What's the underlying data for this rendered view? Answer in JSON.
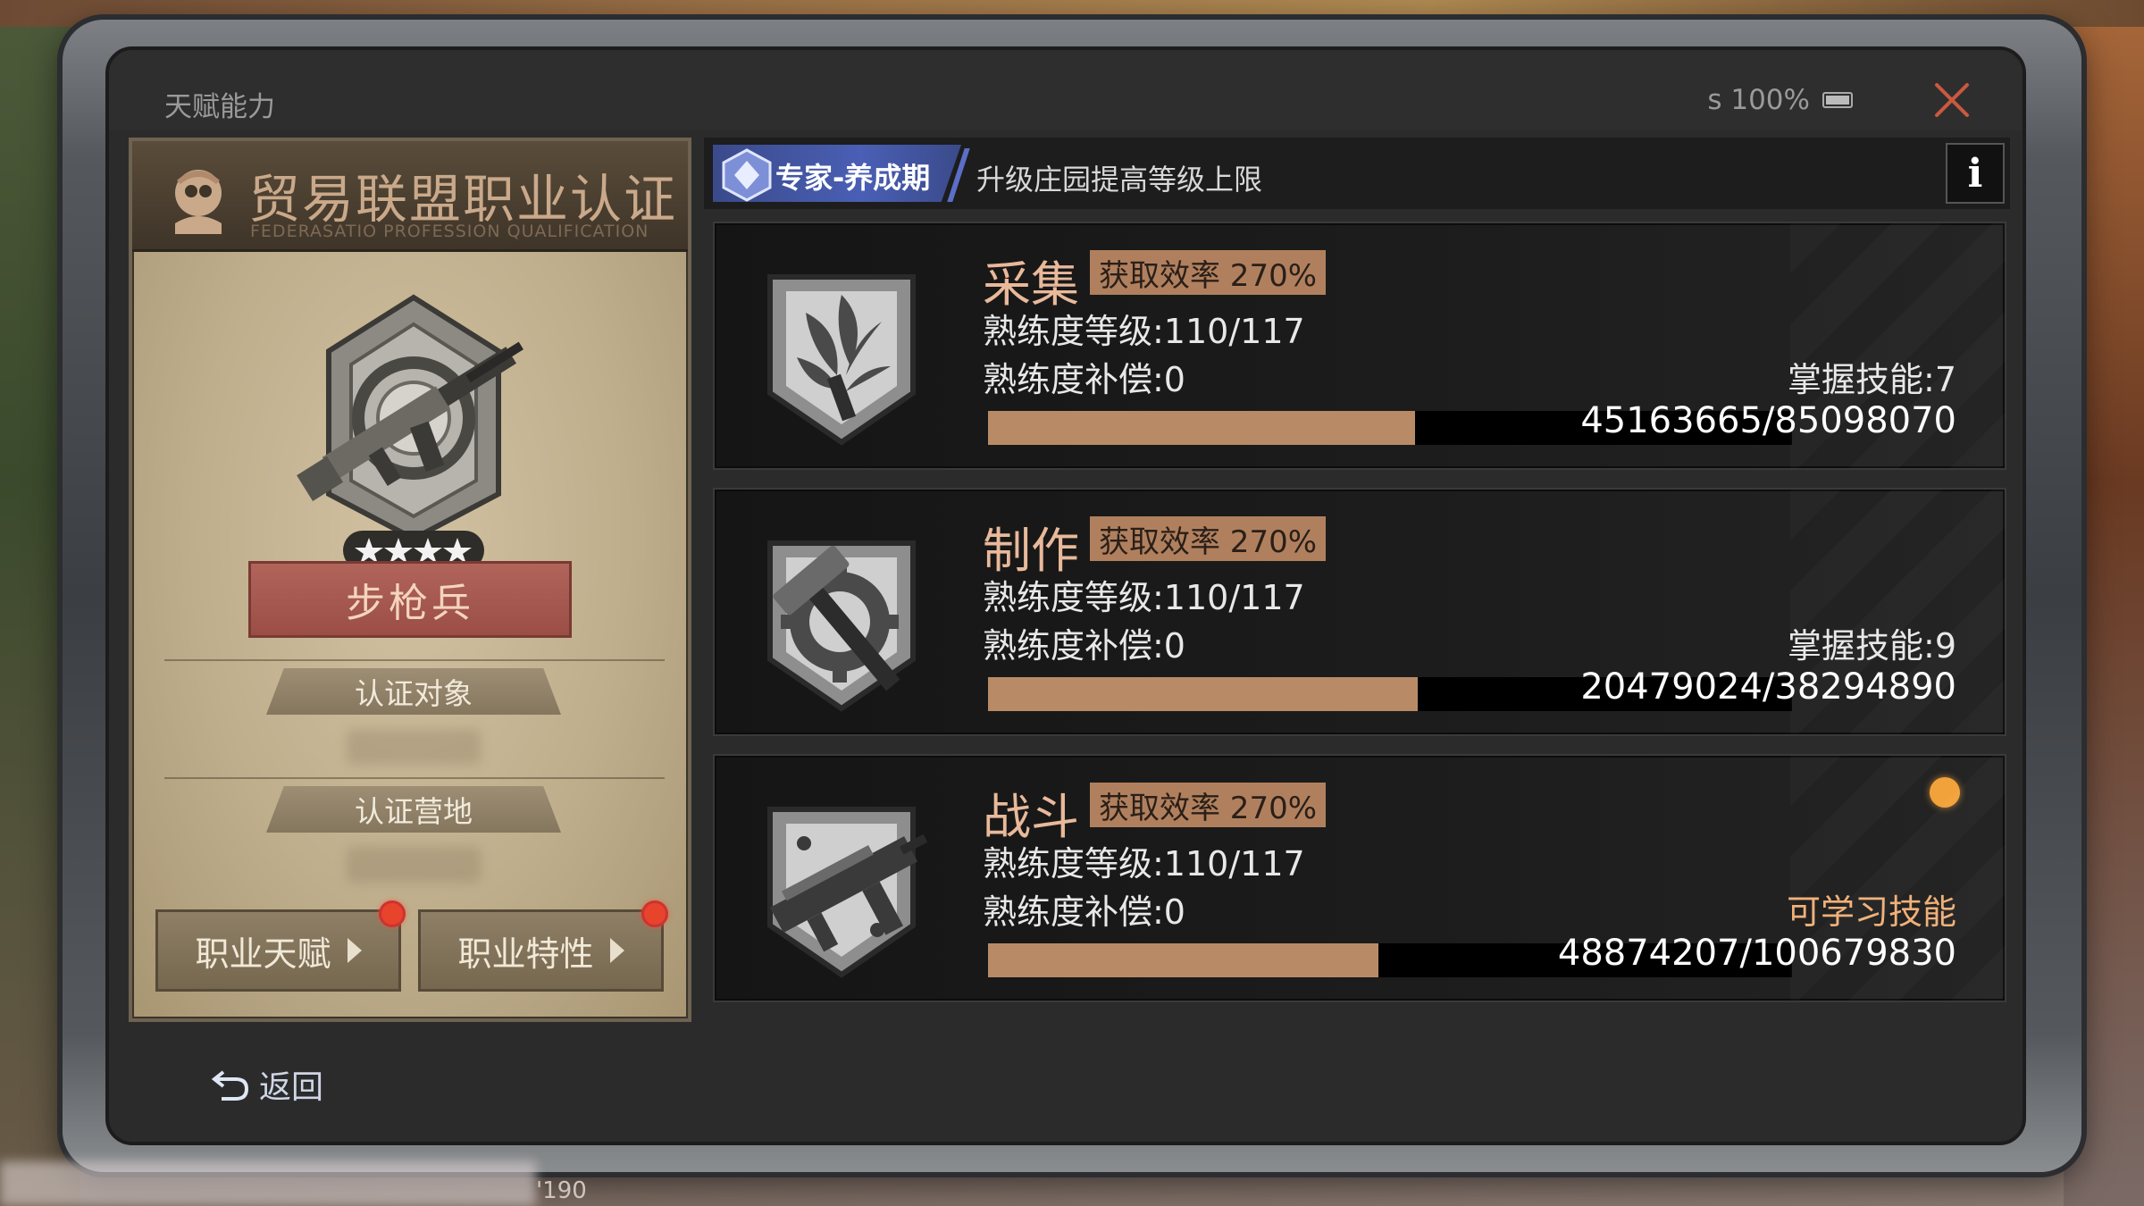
{
  "window": {
    "title": "天赋能力",
    "status_text": "s 100%"
  },
  "left_panel": {
    "cert_title": "贸易联盟职业认证",
    "cert_subtitle": "FEDERASATIO PROFESSION QUALIFICATION",
    "class_name": "步枪兵",
    "cert_target_label": "认证对象",
    "cert_camp_label": "认证营地",
    "buttons": [
      {
        "label": "职业天赋"
      },
      {
        "label": "职业特性"
      }
    ]
  },
  "right_header": {
    "tag_label": "专家-养成期",
    "description": "升级庄园提高等级上限",
    "info_label": "i"
  },
  "skills": [
    {
      "name": "采集",
      "rate": "获取效率 270%",
      "level": "熟练度等级:110/117",
      "compensation": "熟练度补偿:0",
      "right_label": "掌握技能:7",
      "progress_text": "45163665/85098070",
      "progress_value": 45163665,
      "progress_max": 85098070
    },
    {
      "name": "制作",
      "rate": "获取效率 270%",
      "level": "熟练度等级:110/117",
      "compensation": "熟练度补偿:0",
      "right_label": "掌握技能:9",
      "progress_text": "20479024/38294890",
      "progress_value": 20479024,
      "progress_max": 38294890
    },
    {
      "name": "战斗",
      "rate": "获取效率 270%",
      "level": "熟练度等级:110/117",
      "compensation": "熟练度补偿:0",
      "right_label": "可学习技能",
      "progress_text": "48874207/100679830",
      "progress_value": 48874207,
      "progress_max": 100679830
    }
  ],
  "back_label": "返回",
  "footer_fragment": "'190",
  "colors": {
    "accent_orange": "#e8b99a",
    "bar_fill": "#b88b66",
    "notify_red": "#e8432b",
    "notify_orange": "#f2a23a",
    "tag_blue": "#4a5fb5"
  }
}
